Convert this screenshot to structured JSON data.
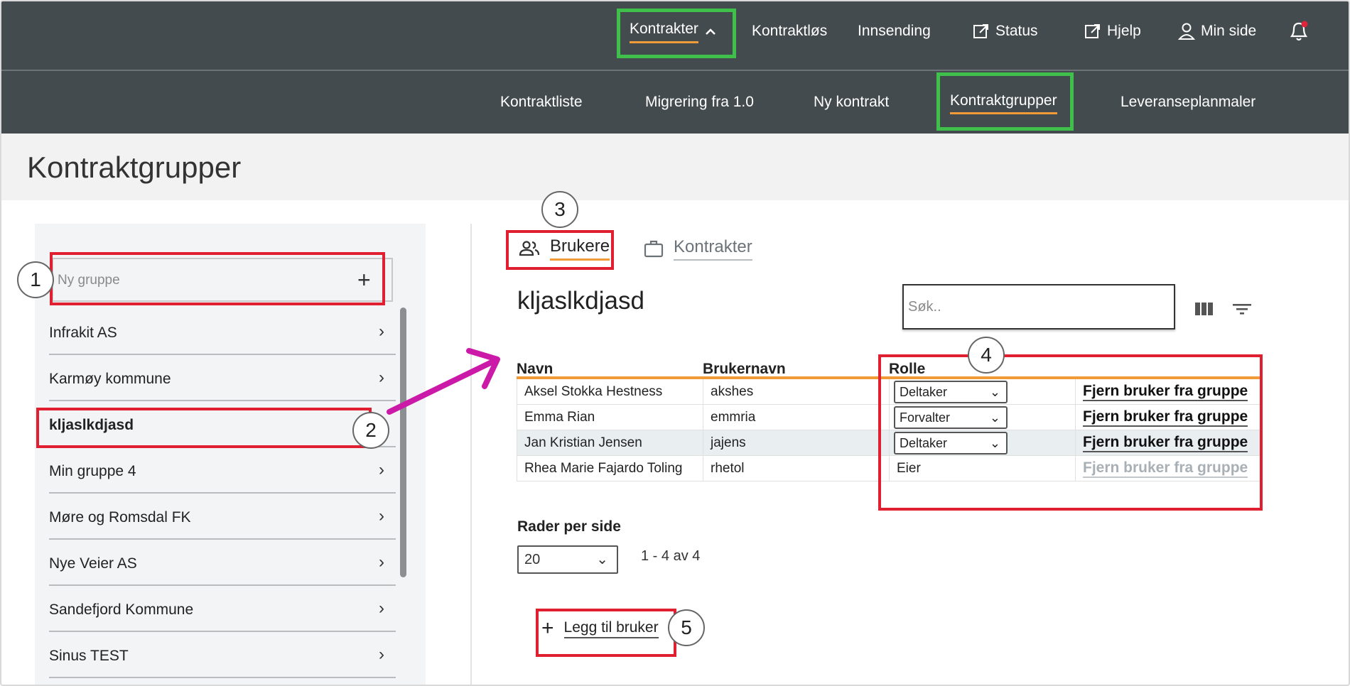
{
  "topnav": {
    "items": [
      {
        "label": "Kontrakter",
        "icon": "chevron-up-icon"
      },
      {
        "label": "Kontraktløs"
      },
      {
        "label": "Innsending"
      },
      {
        "label": "Status",
        "icon": "external-link-icon"
      },
      {
        "label": "Hjelp",
        "icon": "external-link-icon"
      },
      {
        "label": "Min side",
        "icon": "user-icon"
      }
    ],
    "notification_icon": "bell-icon"
  },
  "subnav": {
    "items": [
      {
        "label": "Kontraktliste"
      },
      {
        "label": "Migrering fra 1.0"
      },
      {
        "label": "Ny kontrakt"
      },
      {
        "label": "Kontraktgrupper"
      },
      {
        "label": "Leveranseplanmaler"
      }
    ]
  },
  "page": {
    "title": "Kontraktgrupper"
  },
  "sidebar": {
    "new_group_placeholder": "Ny gruppe",
    "groups": [
      {
        "label": "Infrakit AS"
      },
      {
        "label": "Karmøy kommune"
      },
      {
        "label": "kljaslkdjasd"
      },
      {
        "label": "Min gruppe 4"
      },
      {
        "label": "Møre og Romsdal FK"
      },
      {
        "label": "Nye Veier AS"
      },
      {
        "label": "Sandefjord Kommune"
      },
      {
        "label": "Sinus TEST"
      }
    ]
  },
  "tabs": [
    {
      "label": "Brukere",
      "icon": "users-icon"
    },
    {
      "label": "Kontrakter",
      "icon": "briefcase-icon"
    }
  ],
  "main": {
    "group_title": "kljaslkdjasd",
    "search_placeholder": "Søk..",
    "columns": [
      "Navn",
      "Brukernavn",
      "Rolle"
    ],
    "rows": [
      {
        "name": "Aksel Stokka Hestness",
        "username": "akshes",
        "role": "Deltaker",
        "action": "Fjern bruker fra gruppe"
      },
      {
        "name": "Emma Rian",
        "username": "emmria",
        "role": "Forvalter",
        "action": "Fjern bruker fra gruppe"
      },
      {
        "name": "Jan Kristian Jensen",
        "username": "jajens",
        "role": "Deltaker",
        "action": "Fjern bruker fra gruppe"
      },
      {
        "name": "Rhea Marie Fajardo Toling",
        "username": "rhetol",
        "role": "Eier",
        "action": "Fjern bruker fra gruppe"
      }
    ],
    "rows_per_page_label": "Rader per side",
    "rows_per_page_value": "20",
    "pager_text": "1 - 4 av 4",
    "add_user_label": "Legg til bruker"
  },
  "annotations": [
    "1",
    "2",
    "3",
    "4",
    "5"
  ],
  "colors": {
    "nav_bg": "#444b4e",
    "accent": "#f19a38",
    "highlight_green": "#3fc04a",
    "highlight_red": "#e02030",
    "arrow": "#cc1aa8"
  }
}
